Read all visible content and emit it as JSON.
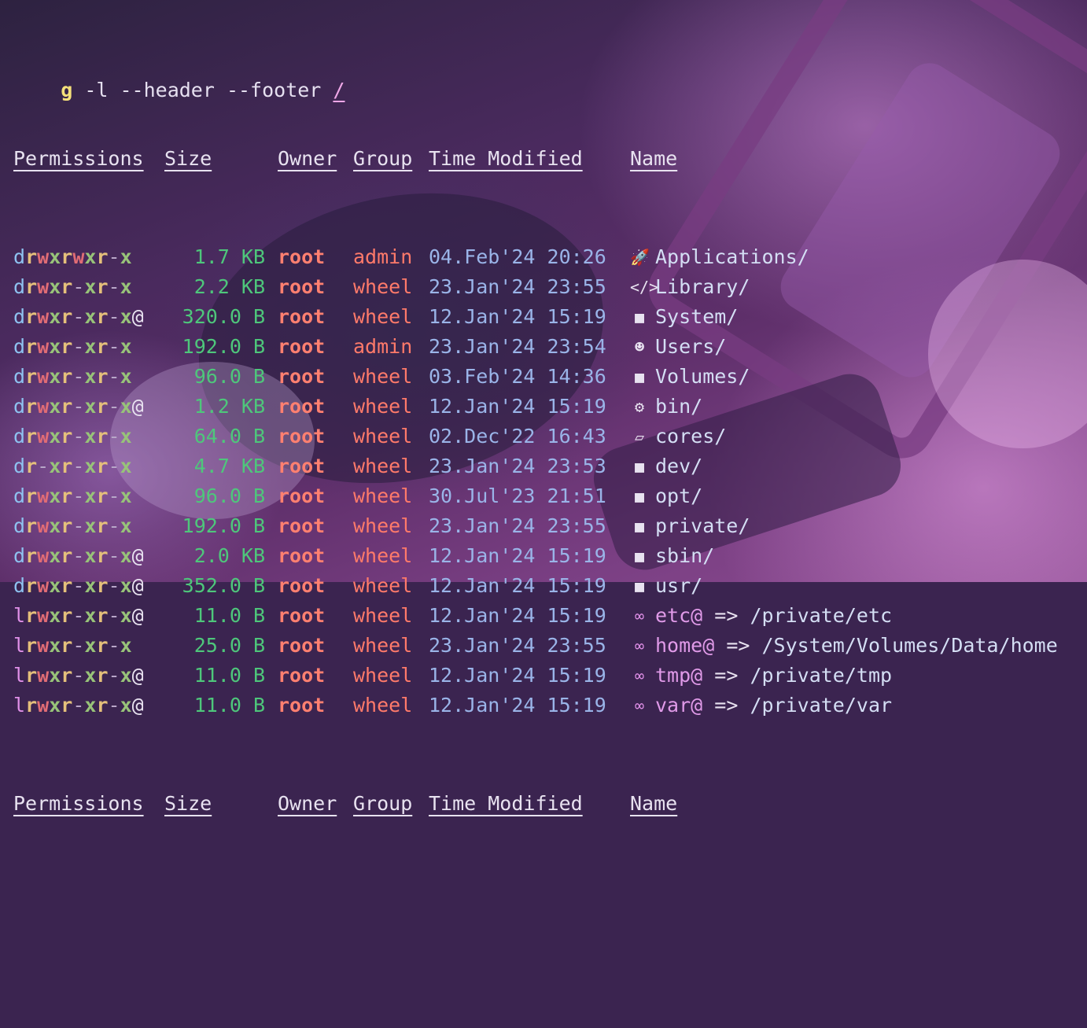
{
  "command": {
    "prog": "g",
    "args": " -l --header --footer ",
    "path": "/"
  },
  "columns": {
    "permissions": "Permissions",
    "size": "Size",
    "owner": "Owner",
    "group": "Group",
    "time": "Time Modified",
    "name": "Name"
  },
  "rows": [
    {
      "type": "d",
      "perm": "rwxrwxr-x",
      "at": "",
      "size": "1.7 KB",
      "owner": "root",
      "group": "admin",
      "time": "04.Feb'24 20:26",
      "icon": "rocket-icon",
      "icon_glyph": "🚀",
      "name": "Applications/",
      "link_target": ""
    },
    {
      "type": "d",
      "perm": "rwxr-xr-x",
      "at": "",
      "size": "2.2 KB",
      "owner": "root",
      "group": "wheel",
      "time": "23.Jan'24 23:55",
      "icon": "code-icon",
      "icon_glyph": "</>",
      "name": "Library/",
      "link_target": ""
    },
    {
      "type": "d",
      "perm": "rwxr-xr-x",
      "at": "@",
      "size": "320.0 B",
      "owner": "root",
      "group": "wheel",
      "time": "12.Jan'24 15:19",
      "icon": "folder-icon",
      "icon_glyph": "■",
      "name": "System/",
      "link_target": ""
    },
    {
      "type": "d",
      "perm": "rwxr-xr-x",
      "at": "",
      "size": "192.0 B",
      "owner": "root",
      "group": "admin",
      "time": "23.Jan'24 23:54",
      "icon": "users-icon",
      "icon_glyph": "☻",
      "name": "Users/",
      "link_target": ""
    },
    {
      "type": "d",
      "perm": "rwxr-xr-x",
      "at": "",
      "size": "96.0 B",
      "owner": "root",
      "group": "wheel",
      "time": "03.Feb'24 14:36",
      "icon": "folder-icon",
      "icon_glyph": "■",
      "name": "Volumes/",
      "link_target": ""
    },
    {
      "type": "d",
      "perm": "rwxr-xr-x",
      "at": "@",
      "size": "1.2 KB",
      "owner": "root",
      "group": "wheel",
      "time": "12.Jan'24 15:19",
      "icon": "folder-gear-icon",
      "icon_glyph": "⚙",
      "name": "bin/",
      "link_target": ""
    },
    {
      "type": "d",
      "perm": "rwxr-xr-x",
      "at": "",
      "size": "64.0 B",
      "owner": "root",
      "group": "wheel",
      "time": "02.Dec'22 16:43",
      "icon": "folder-open-icon",
      "icon_glyph": "▱",
      "name": "cores/",
      "link_target": ""
    },
    {
      "type": "d",
      "perm": "r-xr-xr-x",
      "at": "",
      "size": "4.7 KB",
      "owner": "root",
      "group": "wheel",
      "time": "23.Jan'24 23:53",
      "icon": "folder-icon",
      "icon_glyph": "■",
      "name": "dev/",
      "link_target": ""
    },
    {
      "type": "d",
      "perm": "rwxr-xr-x",
      "at": "",
      "size": "96.0 B",
      "owner": "root",
      "group": "wheel",
      "time": "30.Jul'23 21:51",
      "icon": "folder-icon",
      "icon_glyph": "■",
      "name": "opt/",
      "link_target": ""
    },
    {
      "type": "d",
      "perm": "rwxr-xr-x",
      "at": "",
      "size": "192.0 B",
      "owner": "root",
      "group": "wheel",
      "time": "23.Jan'24 23:55",
      "icon": "folder-icon",
      "icon_glyph": "■",
      "name": "private/",
      "link_target": ""
    },
    {
      "type": "d",
      "perm": "rwxr-xr-x",
      "at": "@",
      "size": "2.0 KB",
      "owner": "root",
      "group": "wheel",
      "time": "12.Jan'24 15:19",
      "icon": "folder-icon",
      "icon_glyph": "■",
      "name": "sbin/",
      "link_target": ""
    },
    {
      "type": "d",
      "perm": "rwxr-xr-x",
      "at": "@",
      "size": "352.0 B",
      "owner": "root",
      "group": "wheel",
      "time": "12.Jan'24 15:19",
      "icon": "folder-icon",
      "icon_glyph": "■",
      "name": "usr/",
      "link_target": ""
    },
    {
      "type": "l",
      "perm": "rwxr-xr-x",
      "at": "@",
      "size": "11.0 B",
      "owner": "root",
      "group": "wheel",
      "time": "12.Jan'24 15:19",
      "icon": "link-icon",
      "icon_glyph": "∞",
      "name": "etc@",
      "link_target": "/private/etc"
    },
    {
      "type": "l",
      "perm": "rwxr-xr-x",
      "at": "",
      "size": "25.0 B",
      "owner": "root",
      "group": "wheel",
      "time": "23.Jan'24 23:55",
      "icon": "link-icon",
      "icon_glyph": "∞",
      "name": "home@",
      "link_target": "/System/Volumes/Data/home"
    },
    {
      "type": "l",
      "perm": "rwxr-xr-x",
      "at": "@",
      "size": "11.0 B",
      "owner": "root",
      "group": "wheel",
      "time": "12.Jan'24 15:19",
      "icon": "link-icon",
      "icon_glyph": "∞",
      "name": "tmp@",
      "link_target": "/private/tmp"
    },
    {
      "type": "l",
      "perm": "rwxr-xr-x",
      "at": "@",
      "size": "11.0 B",
      "owner": "root",
      "group": "wheel",
      "time": "12.Jan'24 15:19",
      "icon": "link-icon",
      "icon_glyph": "∞",
      "name": "var@",
      "link_target": "/private/var"
    }
  ],
  "link_arrow": "=>",
  "colors": {
    "perm_read": "#e5c07b",
    "perm_write": "#e06c75",
    "perm_exec": "#98c379",
    "size": "#4ec77b",
    "owner": "#ff8070",
    "time": "#9ab4e8",
    "symlink": "#e09ae8"
  }
}
